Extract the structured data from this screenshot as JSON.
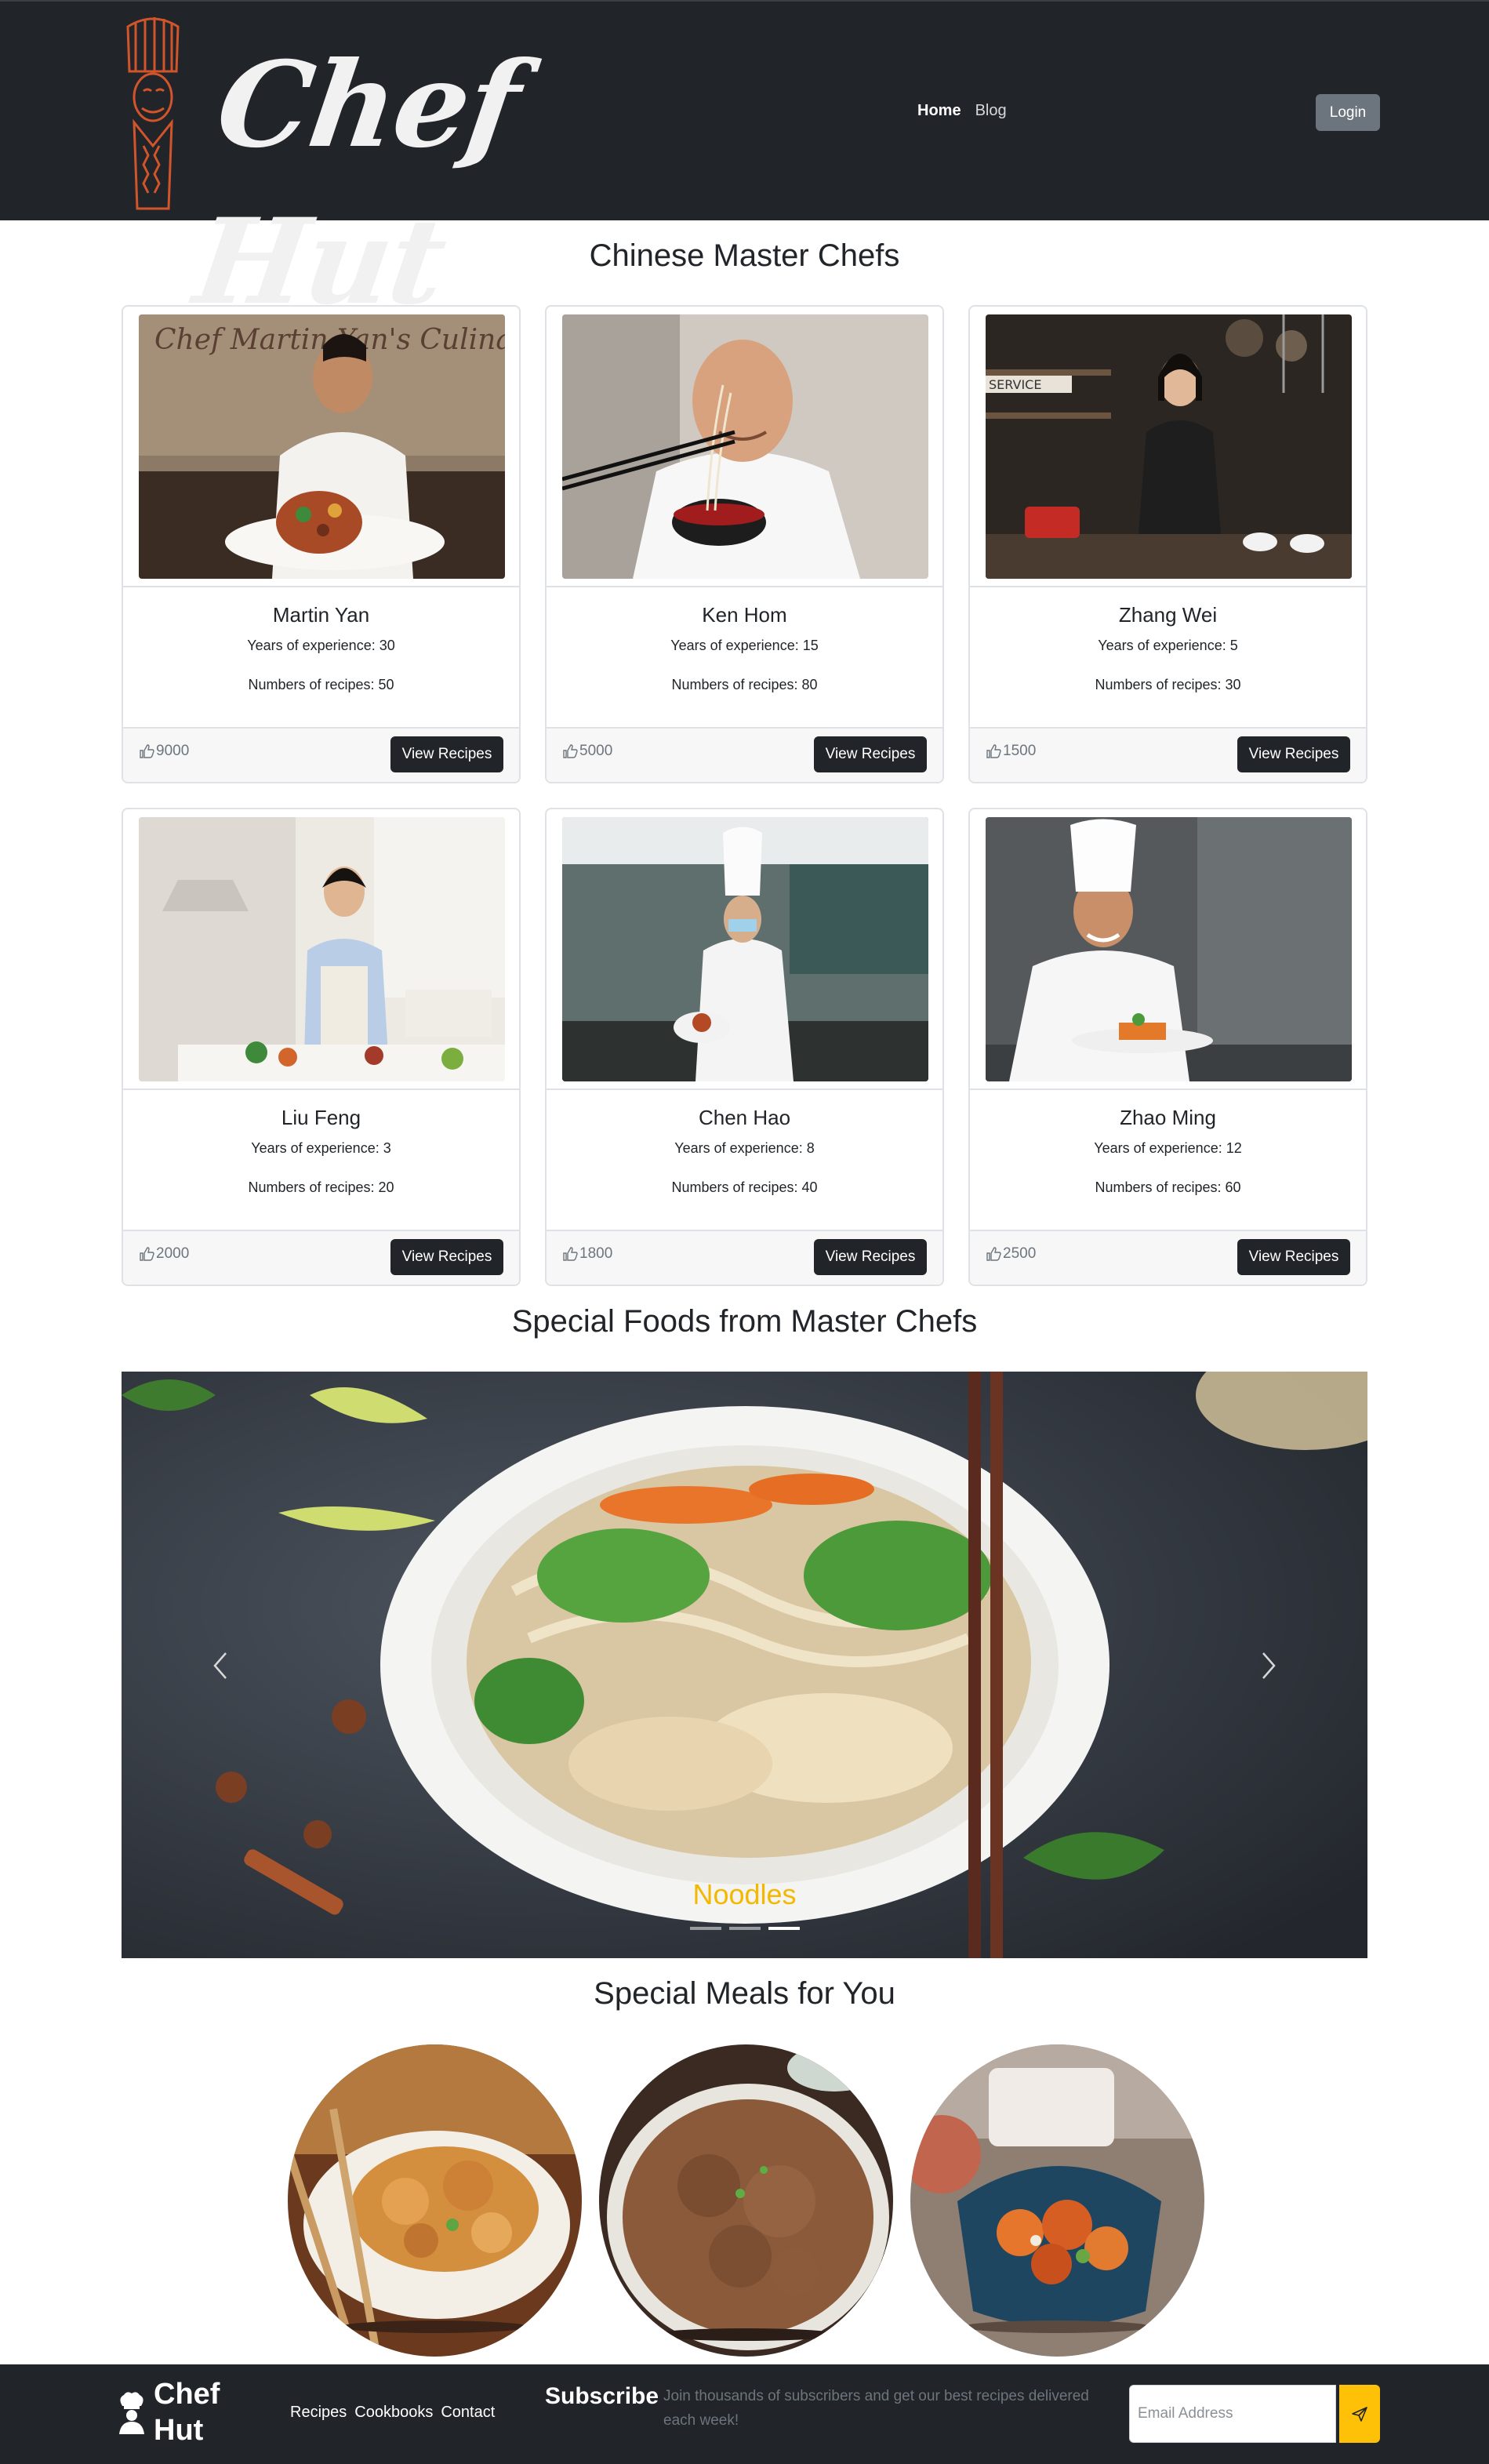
{
  "header": {
    "brand": "Chef Hut",
    "nav": [
      {
        "label": "Home",
        "active": true
      },
      {
        "label": "Blog",
        "active": false
      }
    ],
    "login_label": "Login"
  },
  "chefs_section": {
    "title": "Chinese Master Chefs",
    "view_label": "View Recipes",
    "experience_label": "Years of experience:",
    "recipes_label": "Numbers of recipes:",
    "chefs": [
      {
        "name": "Martin Yan",
        "experience": "Years of experience: 30",
        "recipes": "Numbers of recipes: 50",
        "likes": "9000"
      },
      {
        "name": "Ken Hom",
        "experience": "Years of experience: 15",
        "recipes": "Numbers of recipes: 80",
        "likes": "5000"
      },
      {
        "name": "Zhang Wei",
        "experience": "Years of experience: 5",
        "recipes": "Numbers of recipes: 30",
        "likes": "1500"
      },
      {
        "name": "Liu Feng",
        "experience": "Years of experience: 3",
        "recipes": "Numbers of recipes: 20",
        "likes": "2000"
      },
      {
        "name": "Chen Hao",
        "experience": "Years of experience: 8",
        "recipes": "Numbers of recipes: 40",
        "likes": "1800"
      },
      {
        "name": "Zhao Ming",
        "experience": "Years of experience: 12",
        "recipes": "Numbers of recipes: 60",
        "likes": "2500"
      }
    ],
    "photo_signs": {
      "martin": "Chef Martin Yan's Culinary Arts Center",
      "zhang": "SERVICE"
    }
  },
  "foods_section": {
    "title": "Special Foods from Master Chefs",
    "caption": "Noodles",
    "slide_count": 3,
    "active_slide": 3
  },
  "meals_section": {
    "title": "Special Meals for You"
  },
  "footer": {
    "brand_line1": "Chef",
    "brand_line2": "Hut",
    "links": [
      "Recipes",
      "Cookbooks",
      "Contact"
    ],
    "subscribe_title": "Subscribe",
    "subscribe_text": "Join thousands of subscribers and get our best recipes delivered each week!",
    "email_placeholder": "Email Address"
  },
  "colors": {
    "dark": "#212529",
    "accent_orange": "#d2542a",
    "caption_yellow": "#f5b800",
    "subscribe_button": "#ffc107"
  }
}
